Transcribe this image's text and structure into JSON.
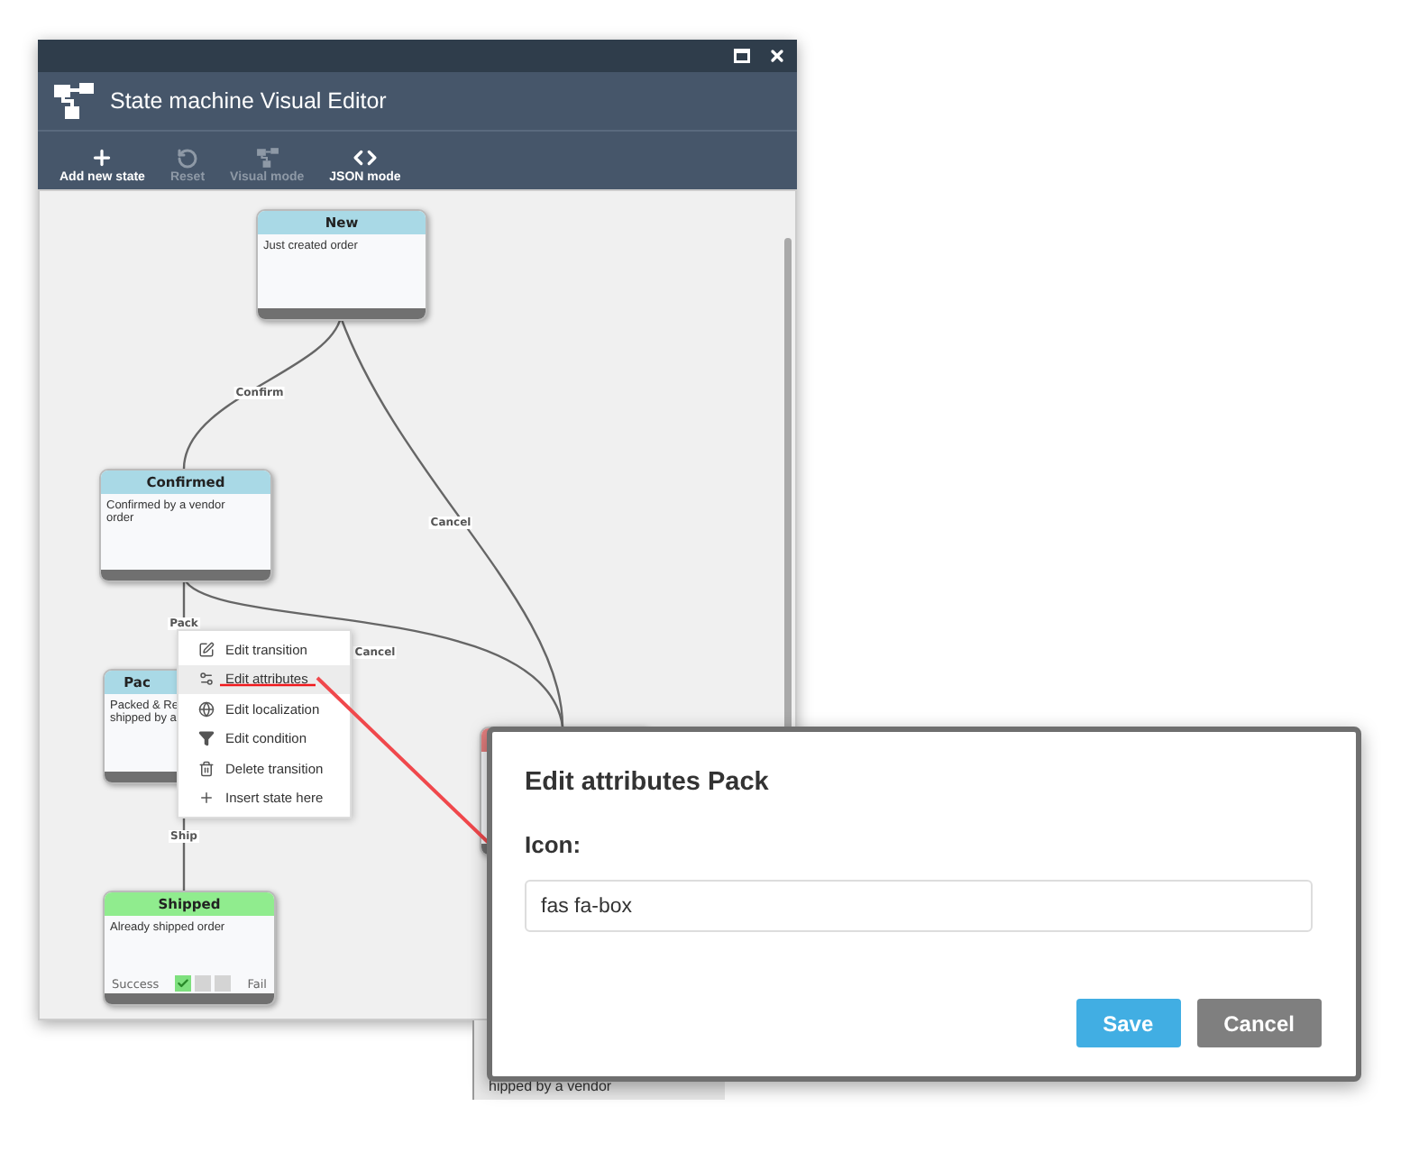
{
  "window": {
    "title": "State machine Visual Editor"
  },
  "toolbar": [
    {
      "label": "Add new state",
      "kind": "add",
      "disabled": false
    },
    {
      "label": "Reset",
      "kind": "reset",
      "disabled": true
    },
    {
      "label": "Visual mode",
      "kind": "visual",
      "disabled": true
    },
    {
      "label": "JSON mode",
      "kind": "json",
      "disabled": false
    }
  ],
  "states": [
    {
      "name": "New",
      "description": [
        "Just created order"
      ],
      "kind": "normal"
    },
    {
      "name": "Confirmed",
      "description": [
        "Confirmed by a vendor",
        "order"
      ],
      "kind": "normal"
    },
    {
      "name": "Pac",
      "description": [
        "Packed & Re",
        "shipped by a"
      ],
      "kind": "normal"
    },
    {
      "name": "Shipped",
      "description": [
        "Already shipped order"
      ],
      "kind": "success",
      "footer": {
        "success_label": "Success",
        "fail_label": "Fail",
        "boxes": [
          {
            "checked": true
          },
          {
            "checked": false
          },
          {
            "checked": false
          }
        ]
      }
    },
    {
      "kind": "failed"
    }
  ],
  "transitions": [
    {
      "label": "Confirm"
    },
    {
      "label": "Cancel"
    },
    {
      "label": "Pack"
    },
    {
      "label": "Cancel"
    },
    {
      "label": "Ship"
    }
  ],
  "context_menu": {
    "items": [
      {
        "label": "Edit transition",
        "kind": "edit",
        "selected": false
      },
      {
        "label": "Edit attributes",
        "kind": "attributes",
        "selected": true
      },
      {
        "label": "Edit localization",
        "kind": "localization",
        "selected": false
      },
      {
        "label": "Edit condition",
        "kind": "condition",
        "selected": false
      },
      {
        "label": "Delete transition",
        "kind": "delete",
        "selected": false
      },
      {
        "label": "Insert state here",
        "kind": "insert",
        "selected": false
      }
    ]
  },
  "background_fragment": "hipped by a vendor",
  "dialog": {
    "title": "Edit attributes Pack",
    "field_label": "Icon:",
    "value": "fas fa-box",
    "buttons": [
      {
        "label": "Save",
        "kind": "primary"
      },
      {
        "label": "Cancel",
        "kind": "secondary"
      }
    ]
  }
}
